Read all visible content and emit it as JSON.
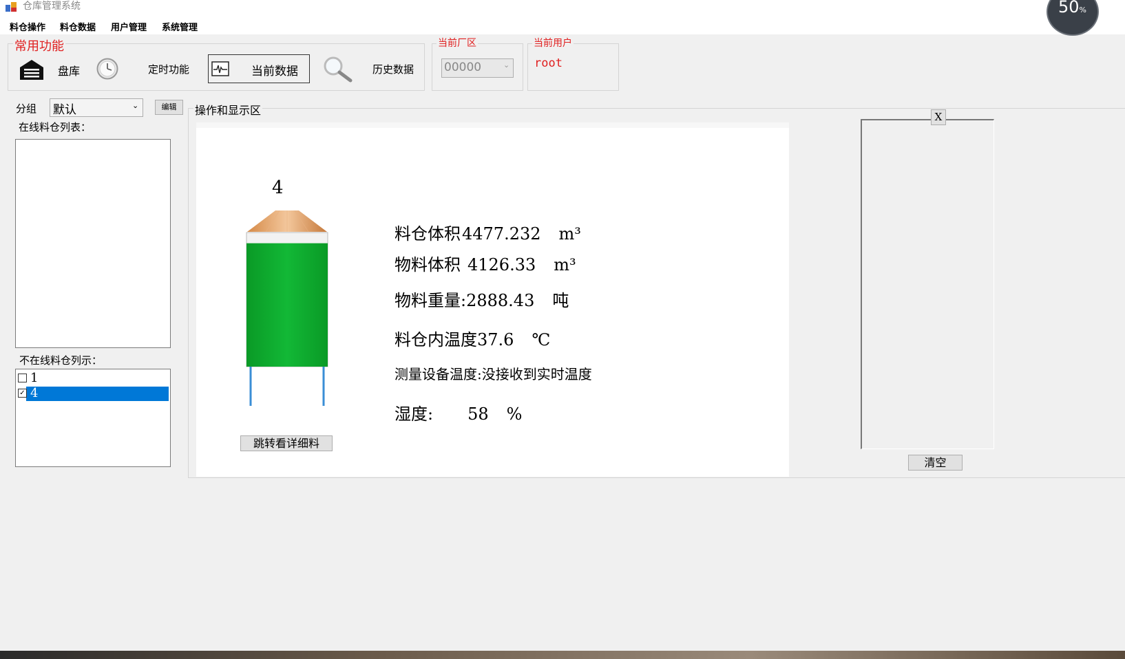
{
  "window": {
    "title": "仓库管理系统"
  },
  "gauge": {
    "value": "50",
    "unit": "%"
  },
  "menu": [
    "料仓操作",
    "料仓数据",
    "用户管理",
    "系统管理"
  ],
  "toolbar": {
    "group_title": "常用功能",
    "inventory": "盘库",
    "timer": "定时功能",
    "current_data": "当前数据",
    "history": "历史数据"
  },
  "plant": {
    "label": "当前厂区",
    "value": "00000"
  },
  "user": {
    "label": "当前用户",
    "value": "root"
  },
  "left": {
    "group_label": "分组",
    "group_value": "默认",
    "edit_button": "编辑",
    "online_label": "在线料仓列表：",
    "offline_label": "不在线料仓列示：",
    "offline_items": [
      {
        "label": "1",
        "checked": false
      },
      {
        "label": "4",
        "checked": true
      }
    ]
  },
  "main": {
    "area_title": "操作和显示区",
    "silo_id": "4",
    "fill_fraction": 0.92,
    "jump_button": "跳转看详细料",
    "rows": {
      "silo_volume": {
        "label": "料仓体积",
        "value": "4477.232",
        "unit": "m³"
      },
      "material_volume": {
        "label": "物料体积",
        "value": "4126.33",
        "unit": "m³"
      },
      "material_weight": {
        "label": "物料重量:",
        "value": "2888.43",
        "unit": "吨"
      },
      "inner_temp": {
        "label": "料仓内温度",
        "value": "37.6",
        "unit": "℃"
      },
      "device_temp": {
        "label": "测量设备温度:",
        "value": "没接收到实时温度"
      },
      "humidity": {
        "label": "湿度:",
        "value": "58",
        "unit": "%"
      }
    }
  },
  "right": {
    "close": "X",
    "clear_button": "清空"
  },
  "colors": {
    "fill": "#0aa82a",
    "accent_red": "#e02020",
    "selection": "#0078d7"
  }
}
